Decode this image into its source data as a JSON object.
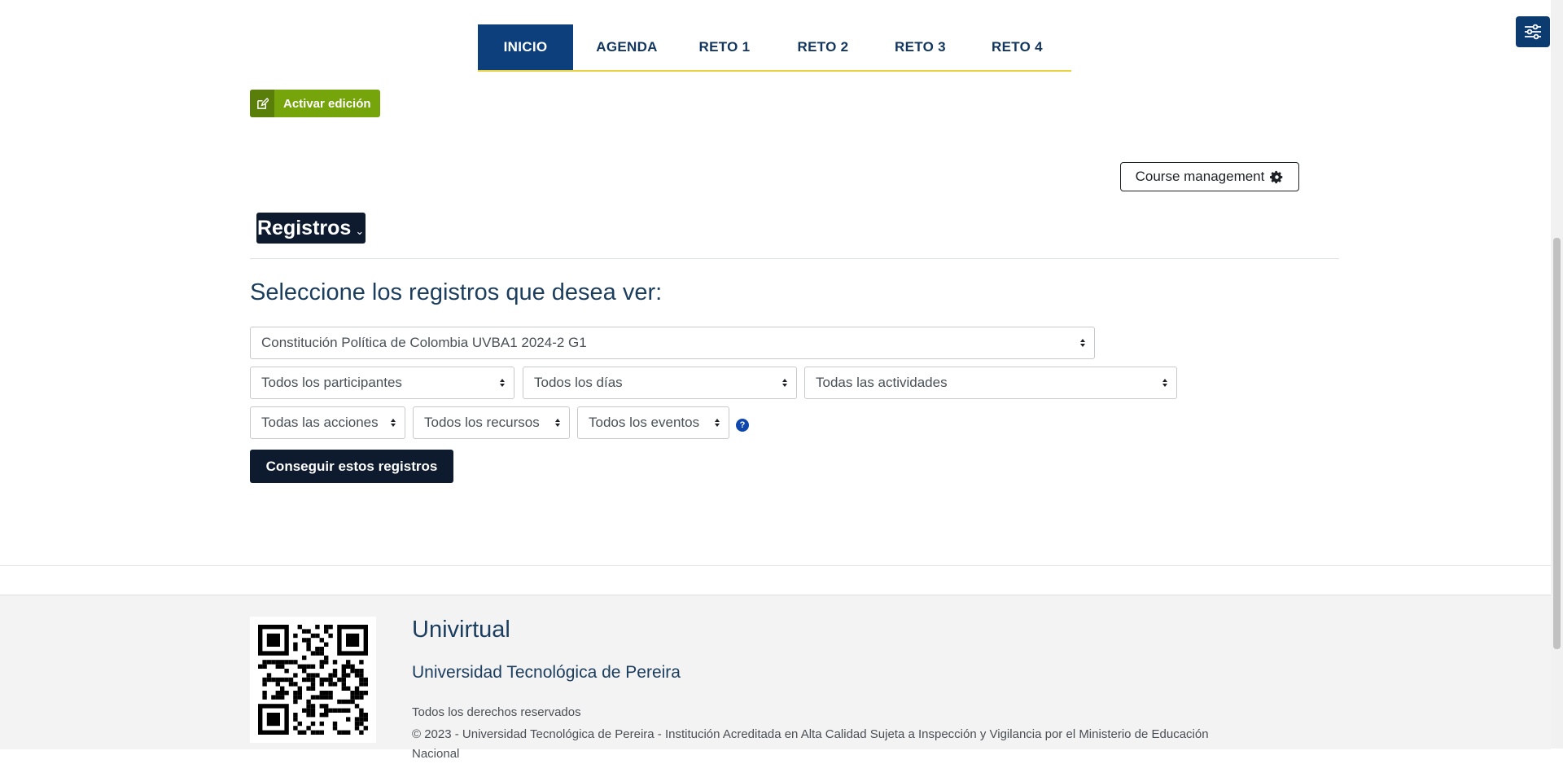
{
  "nav": {
    "tabs": [
      {
        "label": "INICIO",
        "active": true
      },
      {
        "label": "AGENDA"
      },
      {
        "label": "RETO 1"
      },
      {
        "label": "RETO 2"
      },
      {
        "label": "RETO 3"
      },
      {
        "label": "RETO 4"
      }
    ]
  },
  "toolbar": {
    "edit_label": "Activar edición",
    "course_management_label": "Course management"
  },
  "page": {
    "heading": "Registros",
    "subtitle": "Seleccione los registros que desea ver:",
    "filters": {
      "course": "Constitución Política de Colombia UVBA1 2024-2 G1",
      "participants": "Todos los participantes",
      "days": "Todos los días",
      "activities": "Todas las actividades",
      "actions": "Todas las acciones",
      "resources": "Todos los recursos",
      "events": "Todos los eventos"
    },
    "help_glyph": "?",
    "submit_label": "Conseguir estos registros"
  },
  "footer": {
    "title": "Univirtual",
    "university": "Universidad Tecnológica de Pereira",
    "rights": "Todos los derechos reservados",
    "copyright": "© 2023 - Universidad Tecnológica de Pereira - Institución Acreditada en Alta Calidad Sujeta a Inspección y Vigilancia por el Ministerio de Educación Nacional"
  },
  "colors": {
    "primary_nav": "#0d3f7c",
    "accent_yellow": "#e8d33f",
    "edit_green": "#76a40b",
    "dark_button": "#0e1a2e",
    "heading_blue": "#1b3d5e"
  },
  "icons": [
    "settings-sliders-icon",
    "edit-icon",
    "gear-icon",
    "chevron-down-icon",
    "select-arrow-icon",
    "help-icon",
    "qr-code-icon"
  ]
}
